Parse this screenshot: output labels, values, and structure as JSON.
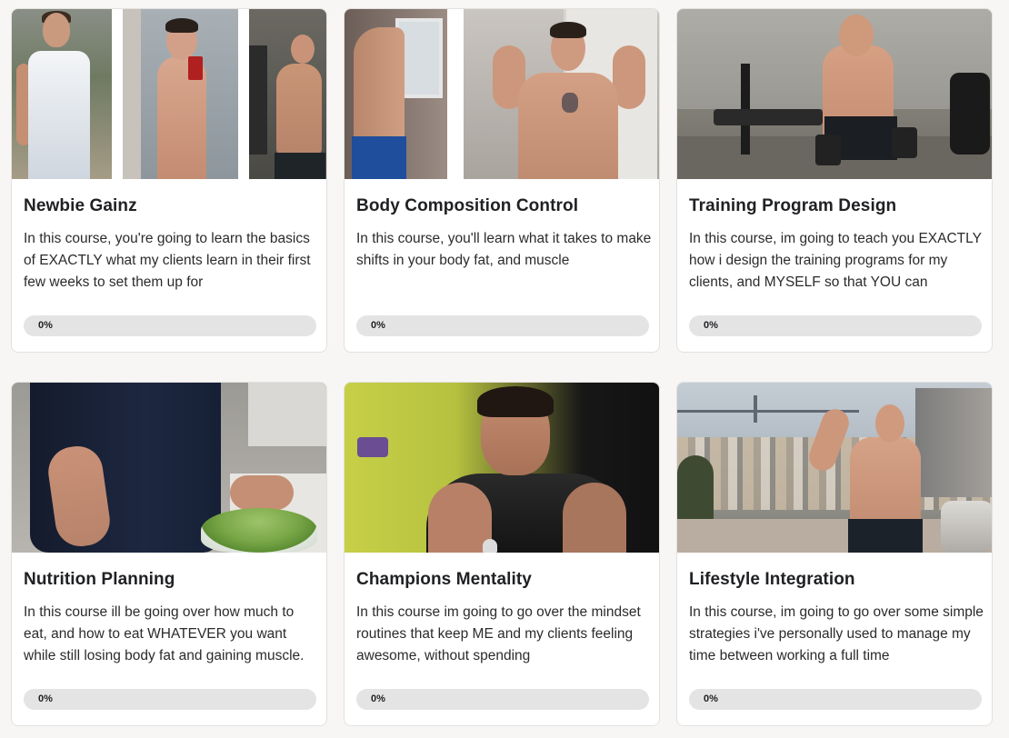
{
  "courses": [
    {
      "title": "Newbie Gainz",
      "description": "In this course, you're going to learn the basics of EXACTLY what my clients learn in their first few weeks to set them up for",
      "progress_label": "0%",
      "progress": 0
    },
    {
      "title": "Body Composition Control",
      "description": "In this course, you'll learn what it takes to make shifts in your body fat, and muscle",
      "progress_label": "0%",
      "progress": 0
    },
    {
      "title": "Training Program Design",
      "description": "In this course, im going to teach you EXACTLY how i design the training programs for my clients, and MYSELF so that YOU can",
      "progress_label": "0%",
      "progress": 0
    },
    {
      "title": "Nutrition Planning",
      "description": "In this course ill be going over how much to eat, and how to eat WHATEVER you want while still losing body fat and gaining muscle.",
      "progress_label": "0%",
      "progress": 0
    },
    {
      "title": "Champions Mentality",
      "description": "In this course im going to go over the mindset routines that keep ME and my clients feeling awesome, without spending",
      "progress_label": "0%",
      "progress": 0
    },
    {
      "title": "Lifestyle Integration",
      "description": "In this course, im going to go over some simple strategies i've personally used to manage my time between working a full time",
      "progress_label": "0%",
      "progress": 0
    }
  ],
  "colors": {
    "page_background": "#f7f6f5",
    "card_background": "#ffffff",
    "progress_track": "#e4e4e4"
  }
}
